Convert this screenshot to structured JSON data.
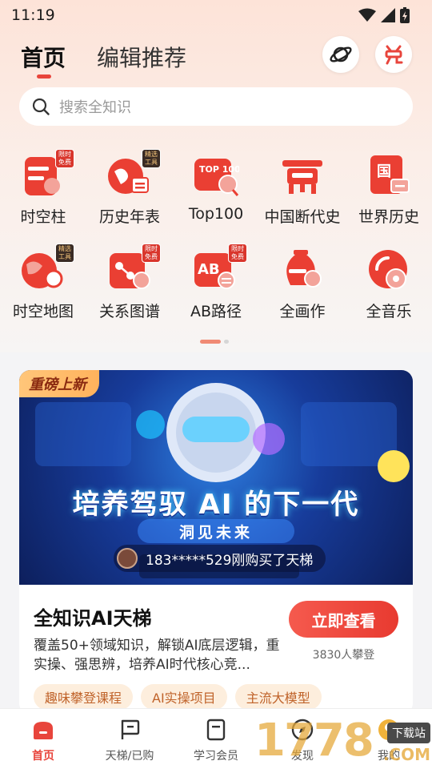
{
  "status_bar": {
    "time": "11:19"
  },
  "header": {
    "tabs": [
      {
        "label": "首页",
        "active": true
      },
      {
        "label": "编辑推荐",
        "active": false
      }
    ]
  },
  "search": {
    "placeholder": "搜索全知识"
  },
  "grid": {
    "items": [
      {
        "label": "时空柱",
        "badge": "限时免费",
        "icon": "timeline-pillar-icon"
      },
      {
        "label": "历史年表",
        "badge": "精选工具",
        "icon": "history-chart-icon"
      },
      {
        "label": "Top100",
        "icon_text": "TOP 100",
        "icon": "top100-icon"
      },
      {
        "label": "中国断代史",
        "icon": "bronze-vessel-icon"
      },
      {
        "label": "世界历史",
        "icon_text": "国",
        "icon": "world-history-book-icon"
      },
      {
        "label": "时空地图",
        "badge": "精选工具",
        "icon": "globe-map-icon"
      },
      {
        "label": "关系图谱",
        "badge": "限时免费",
        "icon": "relation-graph-icon"
      },
      {
        "label": "AB路径",
        "badge": "限时免费",
        "icon_text": "AB",
        "icon": "ab-path-icon"
      },
      {
        "label": "全画作",
        "icon": "vase-painting-icon"
      },
      {
        "label": "全音乐",
        "icon": "music-disc-icon"
      }
    ]
  },
  "pager": {
    "pages": 2,
    "current": 1
  },
  "banner": {
    "tag": "重磅上新",
    "headline": "培养驾驭 AI 的下一代",
    "subline": "洞见未来",
    "purchase_notice": "183*****529刚购买了天梯"
  },
  "card": {
    "title": "全知识AI天梯",
    "description": "覆盖50+领域知识，解锁AI底层逻辑，重实操、强思辨，培养AI时代核心竞...",
    "view_button": "立即查看",
    "climb_count": "3830人攀登",
    "chips": [
      "趣味攀登课程",
      "AI实操项目",
      "主流大模型"
    ]
  },
  "bottom_nav": {
    "items": [
      {
        "label": "首页",
        "active": true,
        "icon": "home-icon"
      },
      {
        "label": "天梯/已购",
        "active": false,
        "icon": "flag-icon"
      },
      {
        "label": "学习会员",
        "active": false,
        "icon": "book-icon"
      },
      {
        "label": "发现",
        "active": false,
        "icon": "compass-icon"
      },
      {
        "label": "我的",
        "active": false,
        "icon": "profile-icon"
      }
    ]
  },
  "watermark": {
    "digits": "1778",
    "tag": "下载站",
    "suffix": ".COM"
  },
  "colors": {
    "accent": "#e8453c",
    "chip_bg": "#fdeedd",
    "chip_text": "#c0632a"
  }
}
